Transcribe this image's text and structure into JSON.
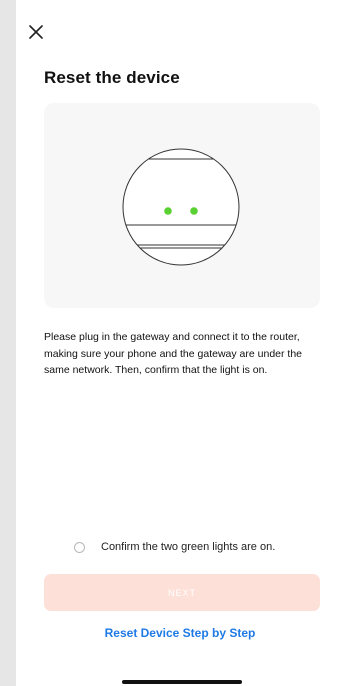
{
  "header": {
    "close_icon": "close-icon"
  },
  "page": {
    "title": "Reset the device"
  },
  "illustration": {
    "name": "gateway-device-illustration",
    "light_color": "#59d132",
    "stroke_color": "#333333"
  },
  "description": {
    "text": "Please plug in the gateway and connect it to the router, making sure your phone and the gateway are under the same network. Then, confirm that the light is on."
  },
  "confirm": {
    "label": "Confirm the two green lights are on.",
    "checked": false
  },
  "actions": {
    "next_label": "NEXT",
    "next_enabled": false,
    "next_color": "#fde0d8",
    "reset_link_label": "Reset Device Step by Step",
    "link_color": "#1f7ae6"
  }
}
